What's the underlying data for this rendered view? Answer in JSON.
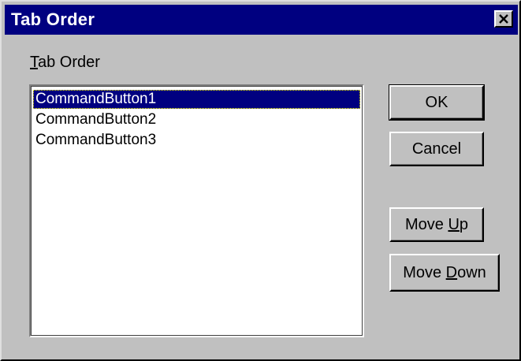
{
  "window": {
    "title": "Tab Order"
  },
  "list": {
    "label_mnemonic": "T",
    "label_rest": "ab Order",
    "items": [
      "CommandButton1",
      "CommandButton2",
      "CommandButton3"
    ],
    "selected_index": 0
  },
  "buttons": {
    "ok": "OK",
    "cancel": "Cancel",
    "move_up_prefix": "Move ",
    "move_up_mnemonic": "U",
    "move_up_suffix": "p",
    "move_down_prefix": "Move ",
    "move_down_mnemonic": "D",
    "move_down_suffix": "own"
  },
  "colors": {
    "titlebar": "#000080",
    "face": "#c0c0c0",
    "selection": "#000080"
  }
}
